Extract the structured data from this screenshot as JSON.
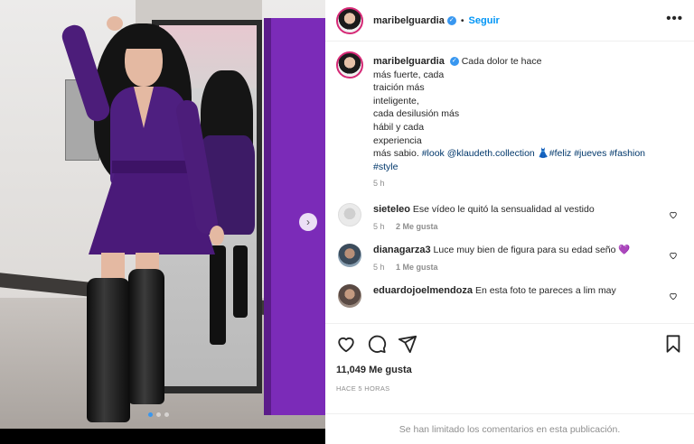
{
  "post": {
    "username": "maribelguardia",
    "follow_label": "Seguir",
    "separator": "•",
    "more_label": "•••",
    "verified_mark": "✓"
  },
  "caption": {
    "username": "maribelguardia",
    "lines": [
      "Cada dolor te hace",
      "más fuerte, cada",
      "traición más",
      "inteligente,",
      "cada desilusión más",
      "hábil y cada",
      "experiencia",
      "más sabio."
    ],
    "tags_1": "#look @klaudeth.collection",
    "emoji": "👗",
    "tags_2": "#feliz #jueves #fashion",
    "tags_3": "#style",
    "time": "5 h"
  },
  "comments": [
    {
      "username": "sieteleo",
      "text": "Ese vídeo le quitó la sensualidad al vestido",
      "time": "5 h",
      "likes": "2 Me gusta"
    },
    {
      "username": "dianagarza3",
      "text": "Luce muy bien de figura para su edad seño",
      "emoji": "💜",
      "time": "5 h",
      "likes": "1 Me gusta"
    },
    {
      "username": "eduardojoelmendoza",
      "text": "En esta foto te pareces a lim may"
    }
  ],
  "actions": {
    "likes": "11,049 Me gusta",
    "ago": "HACE 5 HORAS",
    "limited": "Se han limitado los comentarios en esta publicación."
  },
  "media": {
    "next_arrow": "›",
    "slides": 3,
    "active_slide": 1
  },
  "colors": {
    "accent": "#0095f6",
    "hashtag": "#00376b",
    "muted": "#8e8e8e",
    "wall_purple": "#7b2bb8",
    "dress_purple": "#4e1f80"
  },
  "icons": [
    "heart-icon",
    "comment-icon",
    "share-icon",
    "bookmark-icon",
    "more-icon",
    "verified-icon",
    "chevron-right-icon"
  ]
}
